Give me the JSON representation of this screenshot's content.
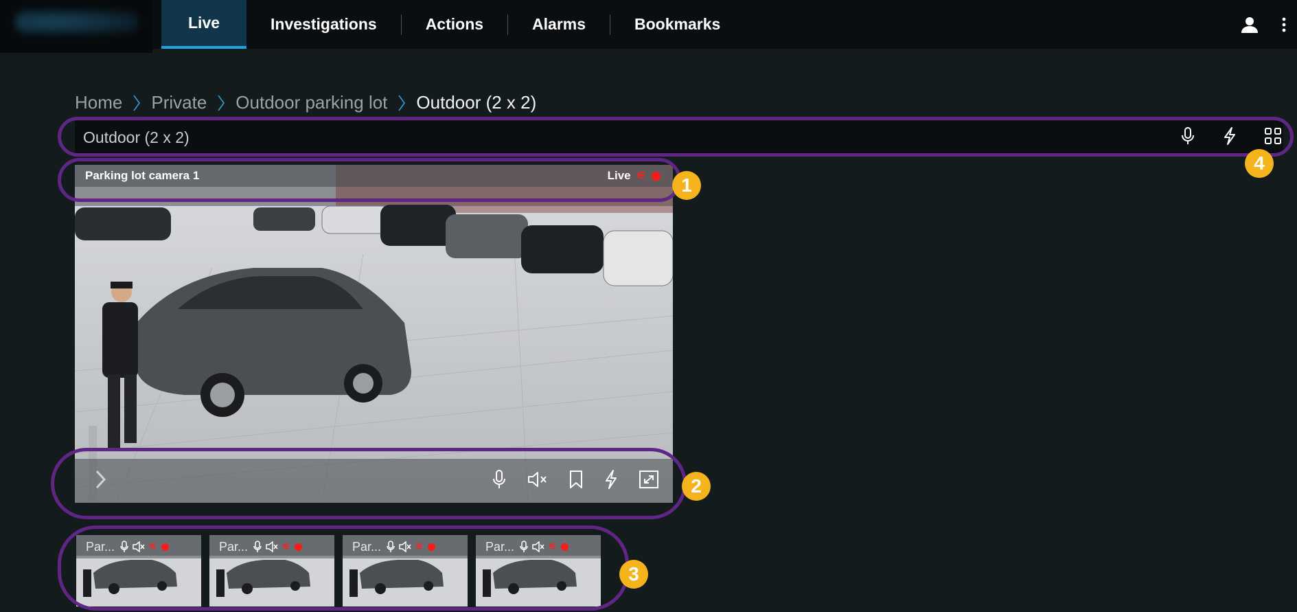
{
  "nav": {
    "items": [
      "Live",
      "Investigations",
      "Actions",
      "Alarms",
      "Bookmarks"
    ],
    "active": "Live",
    "user_icon": "user-icon",
    "more_icon": "more-vertical-icon"
  },
  "breadcrumb": [
    "Home",
    "Private",
    "Outdoor parking lot",
    "Outdoor (2 x 2)"
  ],
  "view": {
    "title": "Outdoor (2 x 2)",
    "icons": [
      "microphone-icon",
      "lightning-icon",
      "grid-icon"
    ]
  },
  "camera": {
    "name": "Parking lot camera 1",
    "status": "Live",
    "controls": [
      "microphone-icon",
      "speaker-muted-icon",
      "bookmark-icon",
      "lightning-icon",
      "fullscreen-icon"
    ]
  },
  "thumbnails": [
    {
      "name": "Par...",
      "selected": true
    },
    {
      "name": "Par...",
      "selected": false
    },
    {
      "name": "Par...",
      "selected": false
    },
    {
      "name": "Par...",
      "selected": false
    }
  ],
  "callouts": [
    "1",
    "2",
    "3",
    "4"
  ],
  "colors": {
    "accent": "#1fa3e4",
    "callout_ring": "#5f2685",
    "callout_badge": "#f6b41c",
    "recording": "#ff1a1a",
    "background": "#141b1d"
  }
}
